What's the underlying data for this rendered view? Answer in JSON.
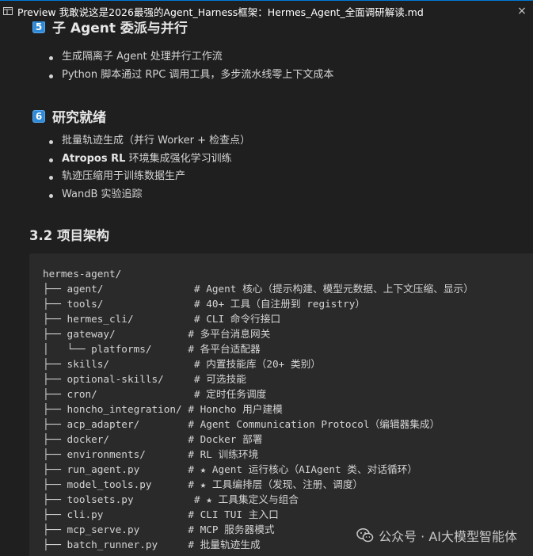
{
  "tab": {
    "icon": "preview-icon",
    "title": "Preview 我敢说这是2026最强的Agent_Harness框架：Hermes_Agent_全面调研解读.md",
    "close": "×"
  },
  "sections": {
    "s5": {
      "num": "5",
      "title": "子 Agent 委派与并行",
      "items": [
        "生成隔离子 Agent 处理并行工作流",
        "Python 脚本通过 RPC 调用工具，多步流水线零上下文成本"
      ]
    },
    "s6": {
      "num": "6",
      "title": "研究就绪",
      "items": [
        "批量轨迹生成（并行 Worker + 检查点）",
        "环境集成强化学习训练",
        "轨迹压缩用于训练数据生产",
        "WandB 实验追踪"
      ],
      "item1_bold": "Atropos RL"
    },
    "s32": {
      "title": "3.2 项目架构"
    }
  },
  "code": {
    "lines": [
      "hermes-agent/",
      "├── agent/               # Agent 核心（提示构建、模型元数据、上下文压缩、显示）",
      "├── tools/               # 40+ 工具（自注册到 registry）",
      "├── hermes_cli/          # CLI 命令行接口",
      "├── gateway/            # 多平台消息网关",
      "│   └── platforms/      # 各平台适配器",
      "├── skills/              # 内置技能库（20+ 类别）",
      "├── optional-skills/     # 可选技能",
      "├── cron/                # 定时任务调度",
      "├── honcho_integration/ # Honcho 用户建模",
      "├── acp_adapter/        # Agent Communication Protocol（编辑器集成）",
      "├── docker/             # Docker 部署",
      "├── environments/       # RL 训练环境",
      "├── run_agent.py        # ★ Agent 运行核心（AIAgent 类、对话循环）",
      "├── model_tools.py      # ★ 工具编排层（发现、注册、调度）",
      "├── toolsets.py          # ★ 工具集定义与组合",
      "├── cli.py              # CLI TUI 主入口",
      "├── mcp_serve.py        # MCP 服务器模式",
      "├── batch_runner.py     # 批量轨迹生成"
    ]
  },
  "watermark": {
    "icon": "wechat-icon",
    "text": "公众号 · AI大模型智能体"
  },
  "colors": {
    "background": "#1f1f1f",
    "code_background": "#2a2a2a",
    "keycap": "#2f8ad8",
    "tab_accent": "#0078d4"
  }
}
